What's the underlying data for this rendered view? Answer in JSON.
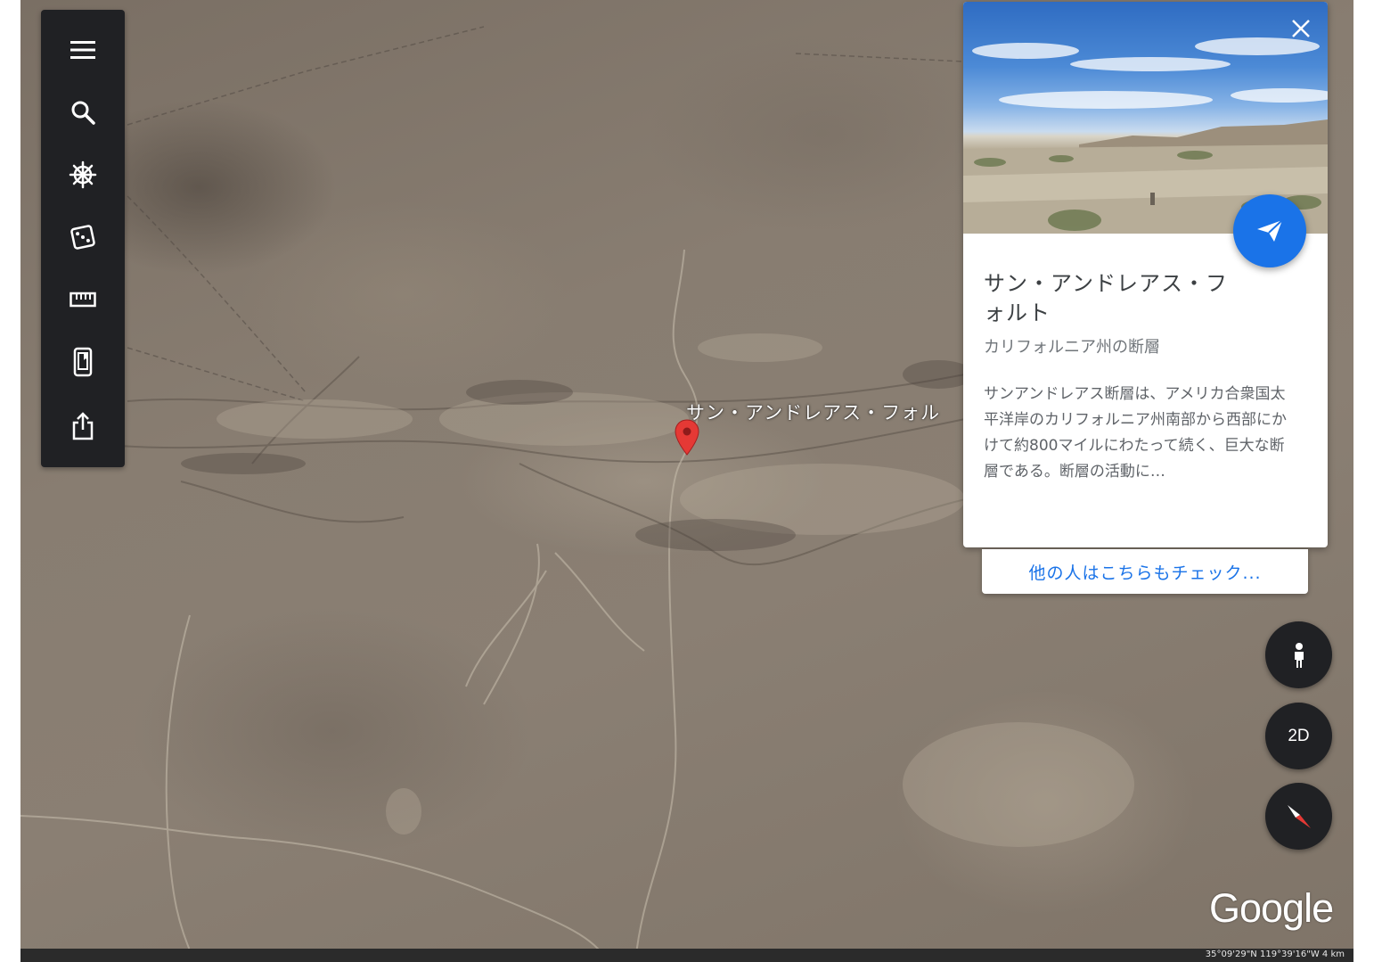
{
  "map": {
    "place_label": "サン・アンドレアス・フォル",
    "coords_readout": "35°09'29\"N 119°39'16\"W 4 km"
  },
  "toolbar": {
    "items": [
      {
        "name": "menu",
        "icon": "hamburger-menu-icon"
      },
      {
        "name": "search",
        "icon": "search-icon"
      },
      {
        "name": "voyager",
        "icon": "ships-wheel-icon"
      },
      {
        "name": "feeling-lucky",
        "icon": "dice-icon"
      },
      {
        "name": "measure",
        "icon": "ruler-icon"
      },
      {
        "name": "projects",
        "icon": "phone-bookmark-icon"
      },
      {
        "name": "share",
        "icon": "share-icon"
      }
    ]
  },
  "info_card": {
    "title": "サン・アンドレアス・フォルト",
    "subtitle": "カリフォルニア州の断層",
    "description": "サンアンドレアス断層は、アメリカ合衆国太平洋岸のカリフォルニア州南部から西部にかけて約800マイルにわたって続く、巨大な断層である。断層の活動に…",
    "more_link": "他の人はこちらもチェック..."
  },
  "controls": {
    "pegman_icon": "pegman-icon",
    "mode_2d_label": "2D",
    "compass_icon": "compass-icon"
  },
  "branding": {
    "logo": "Google"
  },
  "colors": {
    "accent": "#1a73e8",
    "toolbar_bg": "#202124",
    "pin": "#e53935"
  }
}
